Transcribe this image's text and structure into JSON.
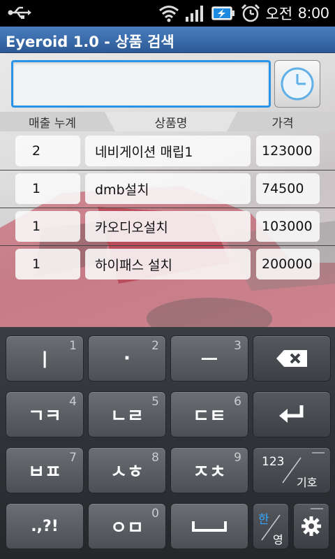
{
  "status_bar": {
    "icons": [
      "usb-icon",
      "wifi-icon",
      "signal-icon",
      "battery-charging-icon",
      "alarm-icon"
    ],
    "ampm": "오전",
    "time": "8:00"
  },
  "app": {
    "title": "Eyeroid 1.0 - 상품 검색"
  },
  "search": {
    "value": "",
    "history_icon": "clock-icon"
  },
  "table": {
    "headers": [
      "매출 누계",
      "상품명",
      "가격"
    ],
    "rows": [
      {
        "count": "2",
        "name": "네비게이션 매립1",
        "price": "123000"
      },
      {
        "count": "1",
        "name": "dmb설치",
        "price": "74500"
      },
      {
        "count": "1",
        "name": "카오디오설치",
        "price": "103000"
      },
      {
        "count": "1",
        "name": "하이패스 설치",
        "price": "200000"
      }
    ]
  },
  "keyboard": {
    "row1": [
      {
        "label": "ㅣ",
        "num": "1"
      },
      {
        "label": "·",
        "num": "2"
      },
      {
        "label": "ㅡ",
        "num": "3"
      },
      {
        "label": "",
        "icon": "backspace-icon"
      }
    ],
    "row2": [
      {
        "label": "ㄱㅋ",
        "num": "4"
      },
      {
        "label": "ㄴㄹ",
        "num": "5"
      },
      {
        "label": "ㄷㅌ",
        "num": "6"
      },
      {
        "label": "",
        "icon": "enter-icon"
      }
    ],
    "row3": [
      {
        "label": "ㅂㅍ",
        "num": "7"
      },
      {
        "label": "ㅅㅎ",
        "num": "8"
      },
      {
        "label": "ㅈㅊ",
        "num": "9"
      },
      {
        "label_top": "123",
        "label_bottom": "기호"
      }
    ],
    "row4": [
      {
        "label": ".,?!"
      },
      {
        "label": "ㅇㅁ",
        "num": "0"
      },
      {
        "label": "",
        "icon": "space-icon"
      },
      {
        "label_top": "한",
        "label_bottom": "영"
      },
      {
        "icon": "settings-gear-icon"
      }
    ],
    "accent_color": "#35a7ff"
  }
}
